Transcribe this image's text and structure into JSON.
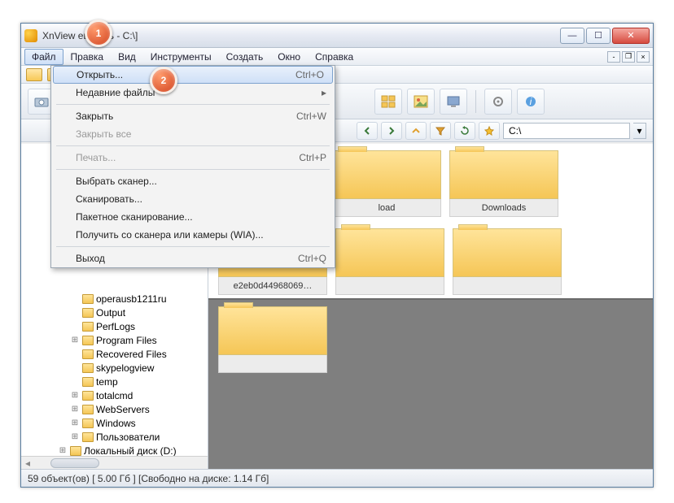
{
  "window": {
    "title": "XnView                еватель - C:\\]"
  },
  "menubar": {
    "items": [
      "Файл",
      "Правка",
      "Вид",
      "Инструменты",
      "Создать",
      "Окно",
      "Справка"
    ],
    "activeIndex": 0
  },
  "dropdown": {
    "open": {
      "label": "Открыть...",
      "shortcut": "Ctrl+O"
    },
    "recent": {
      "label": "Недавние файлы"
    },
    "close": {
      "label": "Закрыть",
      "shortcut": "Ctrl+W"
    },
    "closeAll": {
      "label": "Закрыть все"
    },
    "print": {
      "label": "Печать...",
      "shortcut": "Ctrl+P"
    },
    "selScanner": {
      "label": "Выбрать сканер..."
    },
    "scan": {
      "label": "Сканировать..."
    },
    "batchScan": {
      "label": "Пакетное сканирование..."
    },
    "wia": {
      "label": "Получить со сканера или камеры (WIA)..."
    },
    "exit": {
      "label": "Выход",
      "shortcut": "Ctrl+Q"
    }
  },
  "address": {
    "path": "C:\\"
  },
  "tree": {
    "items": [
      {
        "indent": 60,
        "tw": "",
        "label": "operausb1211ru"
      },
      {
        "indent": 60,
        "tw": "",
        "label": "Output"
      },
      {
        "indent": 60,
        "tw": "",
        "label": "PerfLogs"
      },
      {
        "indent": 60,
        "tw": "+",
        "label": "Program Files"
      },
      {
        "indent": 60,
        "tw": "",
        "label": "Recovered Files"
      },
      {
        "indent": 60,
        "tw": "",
        "label": "skypelogview"
      },
      {
        "indent": 60,
        "tw": "",
        "label": "temp"
      },
      {
        "indent": 60,
        "tw": "+",
        "label": "totalcmd"
      },
      {
        "indent": 60,
        "tw": "+",
        "label": "WebServers"
      },
      {
        "indent": 60,
        "tw": "+",
        "label": "Windows"
      },
      {
        "indent": 60,
        "tw": "+",
        "label": "Пользователи"
      },
      {
        "indent": 45,
        "tw": "+",
        "label": "Локальный диск (D:)"
      }
    ]
  },
  "thumbs": {
    "row1": [
      "load",
      "Downloads",
      "e2eb0d44968069…"
    ],
    "row2": [
      "",
      "",
      ""
    ]
  },
  "status": {
    "text": "59 объект(ов) [ 5.00 Гб ] [Свободно на диске: 1.14 Гб]"
  },
  "callouts": {
    "one": "1",
    "two": "2"
  }
}
